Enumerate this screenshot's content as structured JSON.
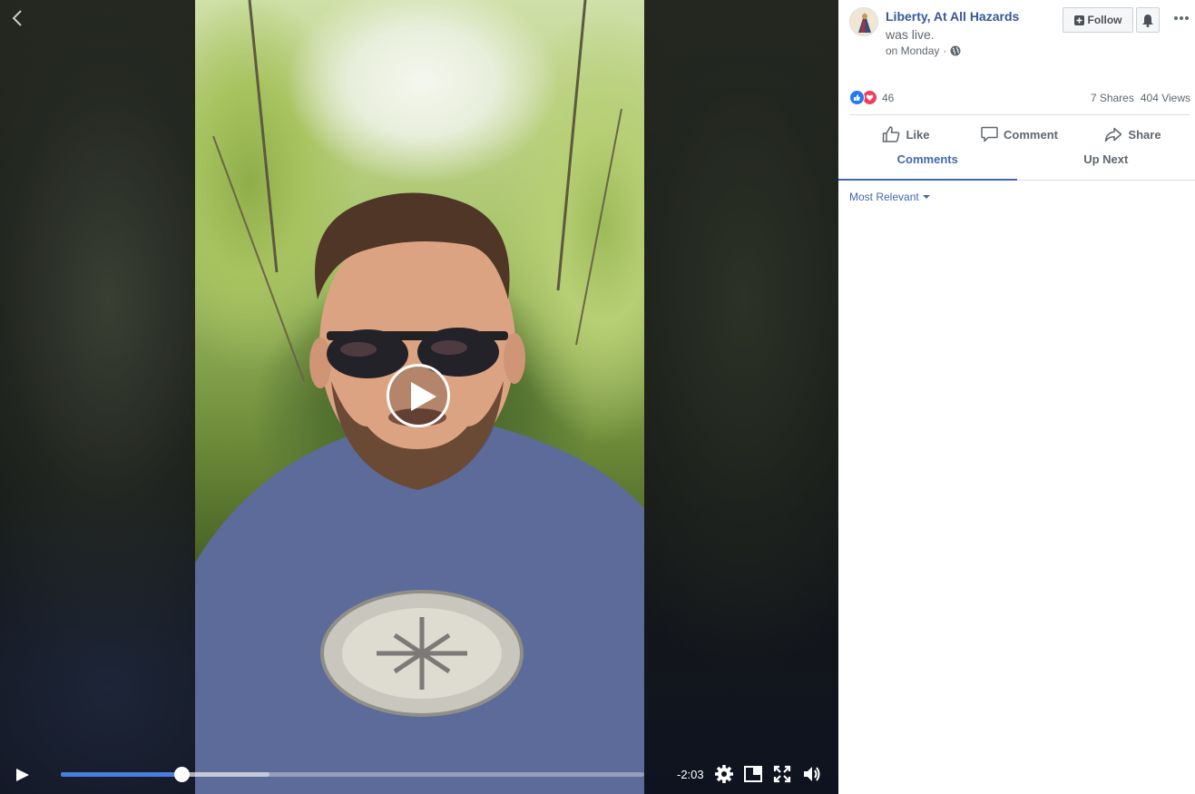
{
  "video": {
    "time_remaining": "-2:03",
    "progress_fraction": 0.207,
    "buffered_fraction": 0.358
  },
  "post": {
    "page_name": "Liberty, At All Hazards",
    "status": "was live.",
    "date": "on Monday",
    "separator": "·",
    "follow_label": "Follow",
    "reaction_count": "46",
    "shares": "7 Shares",
    "views": "404 Views"
  },
  "actions": {
    "like": "Like",
    "comment": "Comment",
    "share": "Share"
  },
  "tabs": [
    {
      "label": "Comments",
      "active": true
    },
    {
      "label": "Up Next",
      "active": false
    }
  ],
  "comments": {
    "sort_label": "Most Relevant"
  },
  "colors": {
    "link_blue": "#365899",
    "accent_blue": "#4267b2",
    "seek_blue": "#4a7fe0",
    "like_blue": "#2078f4",
    "love_red": "#f33e58"
  },
  "icons": [
    "back-chevron-icon",
    "play-icon",
    "settings-icon",
    "picture-in-picture-icon",
    "fullscreen-icon",
    "volume-icon",
    "follow-icon",
    "bell-icon",
    "more-icon",
    "globe-icon",
    "like-reaction-icon",
    "love-reaction-icon",
    "thumbs-up-icon",
    "comment-icon",
    "share-icon"
  ]
}
